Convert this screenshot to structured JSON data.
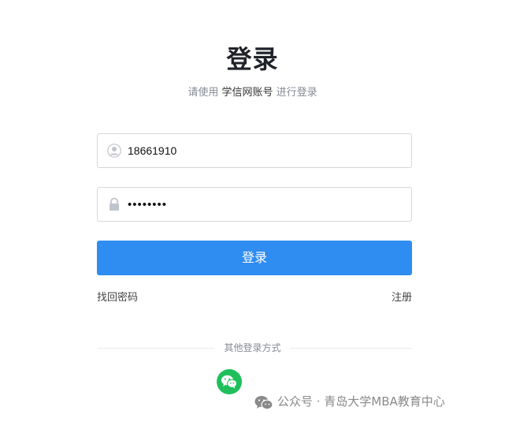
{
  "page": {
    "title": "登录",
    "subtitle_prefix": "请使用",
    "subtitle_account": "学信网账号",
    "subtitle_suffix": "进行登录"
  },
  "form": {
    "username_value": "18661910",
    "username_icon": "user-icon",
    "password_value": "••••••••",
    "password_icon": "lock-icon",
    "login_button": "登录"
  },
  "links": {
    "forgot_password": "找回密码",
    "register": "注册"
  },
  "other_login": {
    "label": "其他登录方式",
    "methods": [
      {
        "icon": "wechat-icon",
        "color": "#1fbf5c"
      }
    ]
  },
  "watermark": {
    "text": "公众号 · 青岛大学MBA教育中心"
  },
  "colors": {
    "primary": "#2f8cf0",
    "wechat": "#1fbf5c"
  }
}
